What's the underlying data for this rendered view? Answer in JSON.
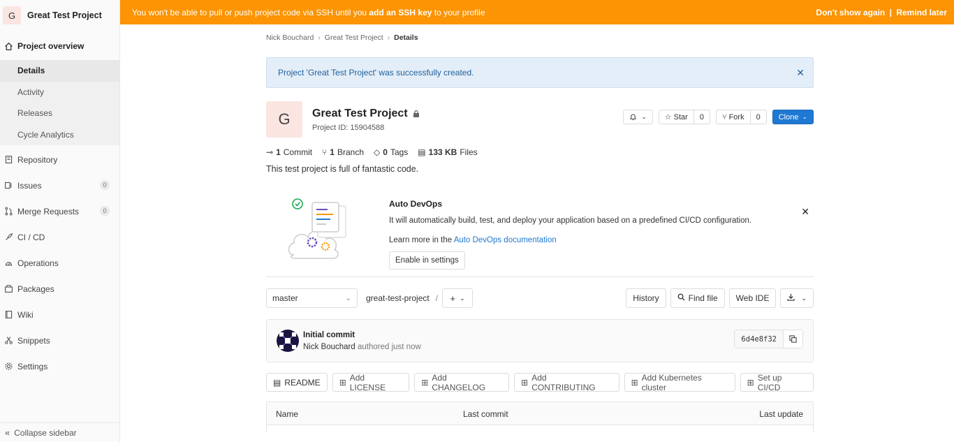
{
  "sidebar": {
    "project_initial": "G",
    "project_name": "Great Test Project",
    "overview_label": "Project overview",
    "overview_items": [
      {
        "label": "Details"
      },
      {
        "label": "Activity"
      },
      {
        "label": "Releases"
      },
      {
        "label": "Cycle Analytics"
      }
    ],
    "items": [
      {
        "label": "Repository",
        "icon": "book-icon"
      },
      {
        "label": "Issues",
        "icon": "issues-icon",
        "badge": "0"
      },
      {
        "label": "Merge Requests",
        "icon": "merge-request-icon",
        "badge": "0"
      },
      {
        "label": "CI / CD",
        "icon": "rocket-icon"
      },
      {
        "label": "Operations",
        "icon": "cloud-gauge-icon"
      },
      {
        "label": "Packages",
        "icon": "package-icon"
      },
      {
        "label": "Wiki",
        "icon": "book-open-icon"
      },
      {
        "label": "Snippets",
        "icon": "scissors-icon"
      },
      {
        "label": "Settings",
        "icon": "gear-icon"
      }
    ],
    "collapse_label": "Collapse sidebar"
  },
  "banner": {
    "text_before": "You won't be able to pull or push project code via SSH until you ",
    "link": "add an SSH key",
    "text_after": " to your profile",
    "dont_show": "Don't show again",
    "separator": "|",
    "remind": "Remind later"
  },
  "breadcrumb": {
    "items": [
      "Nick Bouchard",
      "Great Test Project"
    ],
    "current": "Details"
  },
  "flash": {
    "message": "Project 'Great Test Project' was successfully created."
  },
  "project": {
    "initial": "G",
    "name": "Great Test Project",
    "id_text": "Project ID: 15904588",
    "star_label": "Star",
    "star_count": "0",
    "fork_label": "Fork",
    "fork_count": "0",
    "clone_label": "Clone"
  },
  "stats": {
    "commits_count": "1",
    "commits_label": "Commit",
    "branches_count": "1",
    "branches_label": "Branch",
    "tags_count": "0",
    "tags_label": "Tags",
    "files_size": "133 KB",
    "files_label": "Files"
  },
  "description": "This test project is full of fantastic code.",
  "devops": {
    "title": "Auto DevOps",
    "text": "It will automatically build, test, and deploy your application based on a predefined CI/CD configuration.",
    "learn_prefix": "Learn more in the ",
    "learn_link": "Auto DevOps documentation",
    "button": "Enable in settings"
  },
  "repo": {
    "branch": "master",
    "path": "great-test-project",
    "path_sep": "/",
    "history": "History",
    "find_file": "Find file",
    "web_ide": "Web IDE"
  },
  "commit": {
    "title": "Initial commit",
    "author": "Nick Bouchard",
    "meta": "authored just now",
    "sha": "6d4e8f32"
  },
  "quick_actions": [
    {
      "label": "README",
      "icon": "file-icon"
    },
    {
      "label": "Add LICENSE",
      "icon": "plus-square-icon"
    },
    {
      "label": "Add CHANGELOG",
      "icon": "plus-square-icon"
    },
    {
      "label": "Add CONTRIBUTING",
      "icon": "plus-square-icon"
    },
    {
      "label": "Add Kubernetes cluster",
      "icon": "plus-square-icon"
    },
    {
      "label": "Set up CI/CD",
      "icon": "plus-square-icon"
    }
  ],
  "table": {
    "col_name": "Name",
    "col_last_commit": "Last commit",
    "col_last_update": "Last update"
  },
  "colors": {
    "banner": "#fc9403",
    "primary": "#1f78d1",
    "flash_bg": "#e3eef9"
  }
}
